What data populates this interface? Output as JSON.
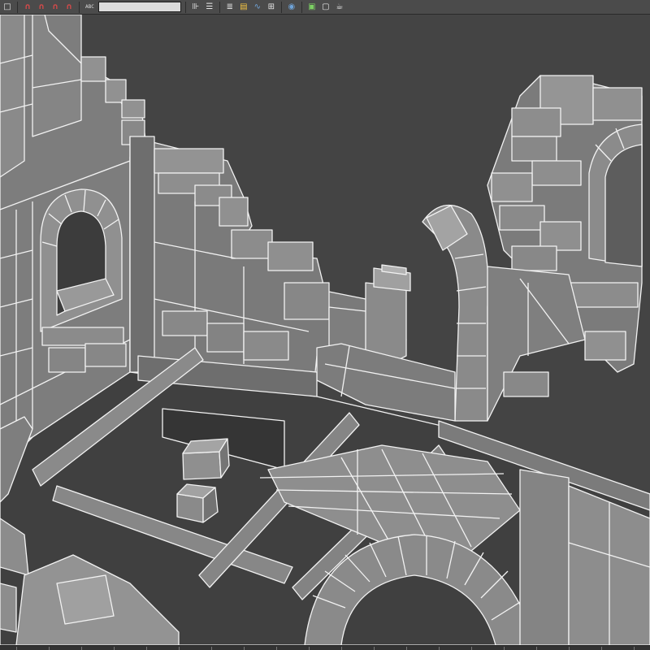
{
  "toolbar": {
    "buttons": [
      {
        "name": "select-object-button",
        "icon": "select-arrow-icon",
        "glyph": "□"
      },
      {
        "name": "snap-toggle-button",
        "icon": "magnet-icon",
        "glyph": "∩"
      },
      {
        "name": "angle-snap-button",
        "icon": "magnet-angle-icon",
        "glyph": "∩"
      },
      {
        "name": "percent-snap-button",
        "icon": "magnet-percent-icon",
        "glyph": "∩"
      },
      {
        "name": "spinner-snap-button",
        "icon": "magnet-spinner-icon",
        "glyph": "∩"
      },
      {
        "name": "edit-named-selection-button",
        "icon": "abc-icon",
        "glyph": "ABC"
      }
    ],
    "named_selection_value": "",
    "right_buttons": [
      {
        "name": "mirror-button",
        "icon": "mirror-icon",
        "glyph": "⊪"
      },
      {
        "name": "align-button",
        "icon": "align-icon",
        "glyph": "☰"
      },
      {
        "name": "layer-manager-button",
        "icon": "layers-icon",
        "glyph": "≣"
      },
      {
        "name": "toggle-scene-explorer-button",
        "icon": "scene-explorer-icon",
        "glyph": "▤"
      },
      {
        "name": "curve-editor-button",
        "icon": "curve-editor-icon",
        "glyph": "∿"
      },
      {
        "name": "schematic-view-button",
        "icon": "schematic-icon",
        "glyph": "⊞"
      },
      {
        "name": "material-editor-button",
        "icon": "material-editor-icon",
        "glyph": "◉"
      },
      {
        "name": "render-setup-button",
        "icon": "render-setup-icon",
        "glyph": "▣"
      },
      {
        "name": "rendered-frame-window-button",
        "icon": "frame-window-icon",
        "glyph": "▢"
      },
      {
        "name": "render-production-button",
        "icon": "teapot-icon",
        "glyph": "☕"
      }
    ]
  },
  "viewport": {
    "background": "#444444",
    "surface_color": "#7f7f7f",
    "edge_color": "#f2f2f2",
    "shade_color": "#5f5f5f"
  }
}
